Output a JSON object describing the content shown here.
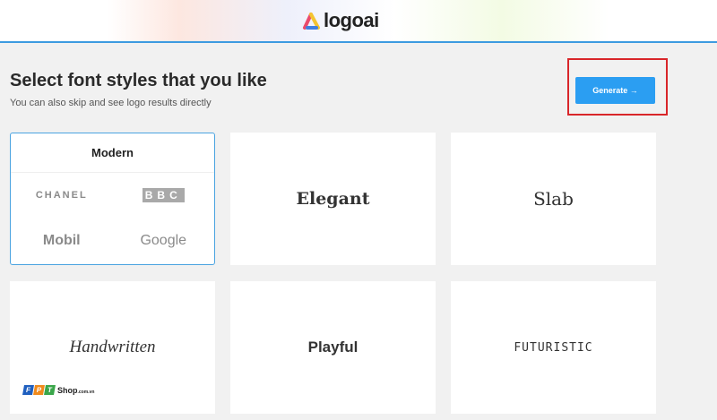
{
  "header": {
    "logo_text": "logoai"
  },
  "page": {
    "title": "Select font styles that you like",
    "subtitle": "You can also skip and see logo results directly",
    "generate_label": "Generate →"
  },
  "styles": [
    {
      "label": "Modern",
      "selected": true,
      "examples": [
        "CHANEL",
        "BBC",
        "Mobil",
        "Google"
      ]
    },
    {
      "label": "Elegant"
    },
    {
      "label": "Slab"
    },
    {
      "label": "Handwritten"
    },
    {
      "label": "Playful"
    },
    {
      "label": "FUTURISTIC"
    }
  ],
  "watermark": {
    "letters": [
      "F",
      "P",
      "T"
    ],
    "text": "Shop",
    "suffix": ".com.vn"
  },
  "colors": {
    "accent": "#2b9ef2",
    "highlight": "#d9262a"
  }
}
